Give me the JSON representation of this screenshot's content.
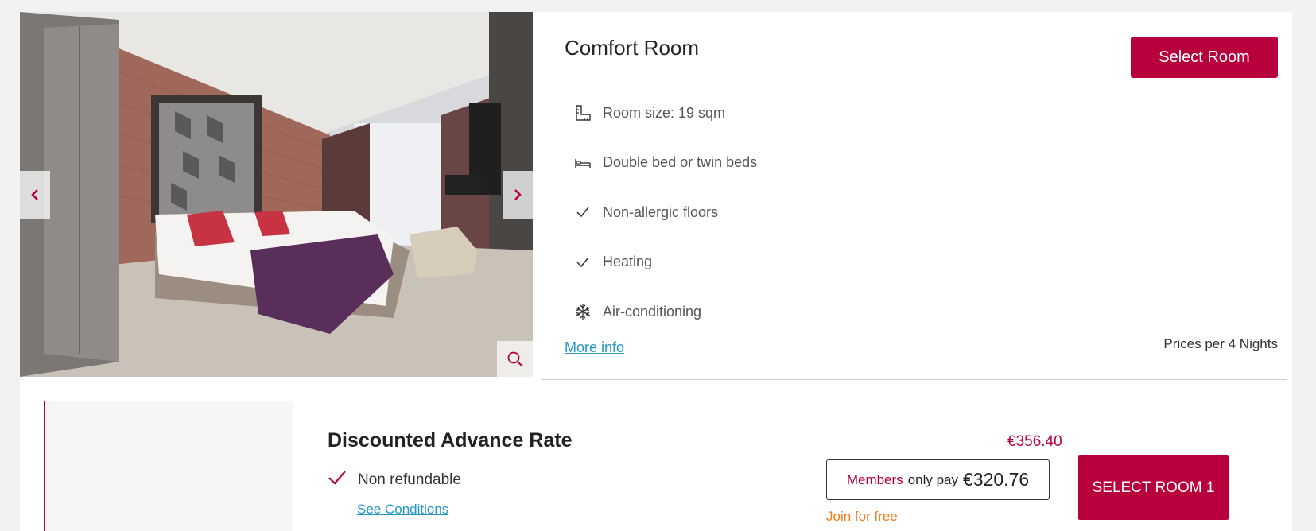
{
  "room": {
    "title": "Comfort Room",
    "select_button": "Select Room",
    "features": [
      {
        "icon": "ruler-icon",
        "label": "Room size: 19 sqm"
      },
      {
        "icon": "bed-icon",
        "label": "Double bed or twin beds"
      },
      {
        "icon": "check-icon",
        "label": "Non-allergic floors"
      },
      {
        "icon": "check-icon",
        "label": "Heating"
      },
      {
        "icon": "snowflake-icon",
        "label": "Air-conditioning"
      }
    ],
    "more_info": "More info",
    "prices_per": "Prices per 4 Nights"
  },
  "gallery": {
    "prev_icon": "chevron-left-icon",
    "next_icon": "chevron-right-icon",
    "zoom_icon": "magnifier-icon"
  },
  "rate": {
    "title": "Discounted Advance Rate",
    "refund_label": "Non refundable",
    "conditions_link": "See Conditions",
    "price": "€356.40",
    "members_label": "Members",
    "members_only": "only pay",
    "members_price": "€320.76",
    "join_label": "Join for free",
    "select_button": "SELECT ROOM 1"
  },
  "colors": {
    "accent": "#b8003d",
    "link": "#2596c6",
    "join": "#f07c1a"
  }
}
